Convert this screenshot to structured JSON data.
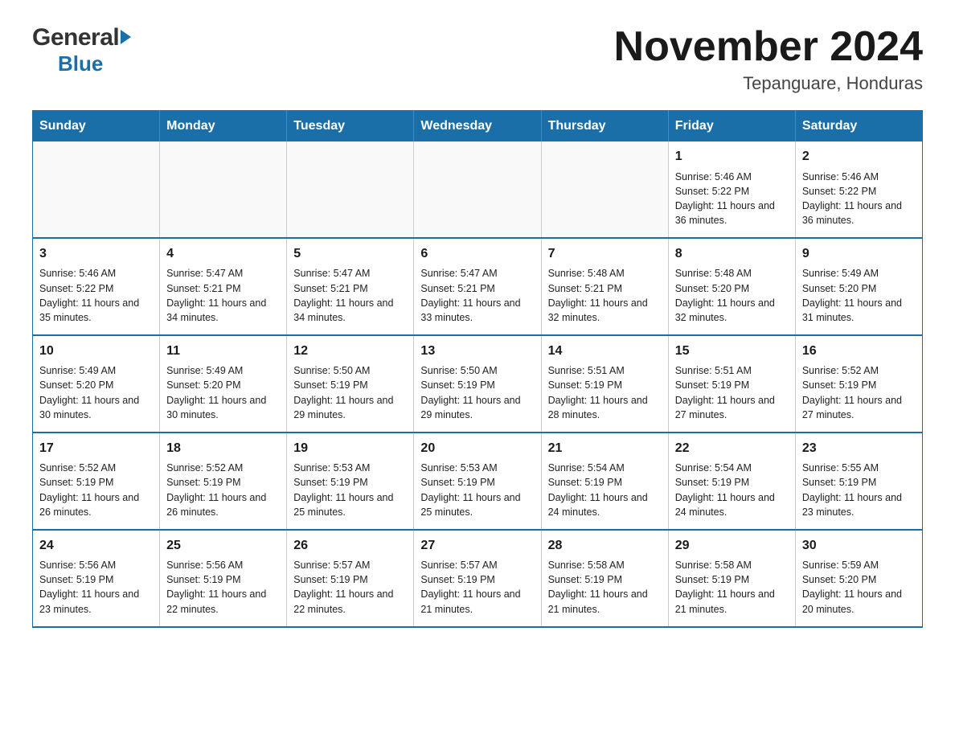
{
  "header": {
    "logo_general": "General",
    "logo_blue": "Blue",
    "month_title": "November 2024",
    "location": "Tepanguare, Honduras"
  },
  "days_of_week": [
    "Sunday",
    "Monday",
    "Tuesday",
    "Wednesday",
    "Thursday",
    "Friday",
    "Saturday"
  ],
  "weeks": [
    [
      {
        "day": "",
        "info": ""
      },
      {
        "day": "",
        "info": ""
      },
      {
        "day": "",
        "info": ""
      },
      {
        "day": "",
        "info": ""
      },
      {
        "day": "",
        "info": ""
      },
      {
        "day": "1",
        "info": "Sunrise: 5:46 AM\nSunset: 5:22 PM\nDaylight: 11 hours and 36 minutes."
      },
      {
        "day": "2",
        "info": "Sunrise: 5:46 AM\nSunset: 5:22 PM\nDaylight: 11 hours and 36 minutes."
      }
    ],
    [
      {
        "day": "3",
        "info": "Sunrise: 5:46 AM\nSunset: 5:22 PM\nDaylight: 11 hours and 35 minutes."
      },
      {
        "day": "4",
        "info": "Sunrise: 5:47 AM\nSunset: 5:21 PM\nDaylight: 11 hours and 34 minutes."
      },
      {
        "day": "5",
        "info": "Sunrise: 5:47 AM\nSunset: 5:21 PM\nDaylight: 11 hours and 34 minutes."
      },
      {
        "day": "6",
        "info": "Sunrise: 5:47 AM\nSunset: 5:21 PM\nDaylight: 11 hours and 33 minutes."
      },
      {
        "day": "7",
        "info": "Sunrise: 5:48 AM\nSunset: 5:21 PM\nDaylight: 11 hours and 32 minutes."
      },
      {
        "day": "8",
        "info": "Sunrise: 5:48 AM\nSunset: 5:20 PM\nDaylight: 11 hours and 32 minutes."
      },
      {
        "day": "9",
        "info": "Sunrise: 5:49 AM\nSunset: 5:20 PM\nDaylight: 11 hours and 31 minutes."
      }
    ],
    [
      {
        "day": "10",
        "info": "Sunrise: 5:49 AM\nSunset: 5:20 PM\nDaylight: 11 hours and 30 minutes."
      },
      {
        "day": "11",
        "info": "Sunrise: 5:49 AM\nSunset: 5:20 PM\nDaylight: 11 hours and 30 minutes."
      },
      {
        "day": "12",
        "info": "Sunrise: 5:50 AM\nSunset: 5:19 PM\nDaylight: 11 hours and 29 minutes."
      },
      {
        "day": "13",
        "info": "Sunrise: 5:50 AM\nSunset: 5:19 PM\nDaylight: 11 hours and 29 minutes."
      },
      {
        "day": "14",
        "info": "Sunrise: 5:51 AM\nSunset: 5:19 PM\nDaylight: 11 hours and 28 minutes."
      },
      {
        "day": "15",
        "info": "Sunrise: 5:51 AM\nSunset: 5:19 PM\nDaylight: 11 hours and 27 minutes."
      },
      {
        "day": "16",
        "info": "Sunrise: 5:52 AM\nSunset: 5:19 PM\nDaylight: 11 hours and 27 minutes."
      }
    ],
    [
      {
        "day": "17",
        "info": "Sunrise: 5:52 AM\nSunset: 5:19 PM\nDaylight: 11 hours and 26 minutes."
      },
      {
        "day": "18",
        "info": "Sunrise: 5:52 AM\nSunset: 5:19 PM\nDaylight: 11 hours and 26 minutes."
      },
      {
        "day": "19",
        "info": "Sunrise: 5:53 AM\nSunset: 5:19 PM\nDaylight: 11 hours and 25 minutes."
      },
      {
        "day": "20",
        "info": "Sunrise: 5:53 AM\nSunset: 5:19 PM\nDaylight: 11 hours and 25 minutes."
      },
      {
        "day": "21",
        "info": "Sunrise: 5:54 AM\nSunset: 5:19 PM\nDaylight: 11 hours and 24 minutes."
      },
      {
        "day": "22",
        "info": "Sunrise: 5:54 AM\nSunset: 5:19 PM\nDaylight: 11 hours and 24 minutes."
      },
      {
        "day": "23",
        "info": "Sunrise: 5:55 AM\nSunset: 5:19 PM\nDaylight: 11 hours and 23 minutes."
      }
    ],
    [
      {
        "day": "24",
        "info": "Sunrise: 5:56 AM\nSunset: 5:19 PM\nDaylight: 11 hours and 23 minutes."
      },
      {
        "day": "25",
        "info": "Sunrise: 5:56 AM\nSunset: 5:19 PM\nDaylight: 11 hours and 22 minutes."
      },
      {
        "day": "26",
        "info": "Sunrise: 5:57 AM\nSunset: 5:19 PM\nDaylight: 11 hours and 22 minutes."
      },
      {
        "day": "27",
        "info": "Sunrise: 5:57 AM\nSunset: 5:19 PM\nDaylight: 11 hours and 21 minutes."
      },
      {
        "day": "28",
        "info": "Sunrise: 5:58 AM\nSunset: 5:19 PM\nDaylight: 11 hours and 21 minutes."
      },
      {
        "day": "29",
        "info": "Sunrise: 5:58 AM\nSunset: 5:19 PM\nDaylight: 11 hours and 21 minutes."
      },
      {
        "day": "30",
        "info": "Sunrise: 5:59 AM\nSunset: 5:20 PM\nDaylight: 11 hours and 20 minutes."
      }
    ]
  ]
}
